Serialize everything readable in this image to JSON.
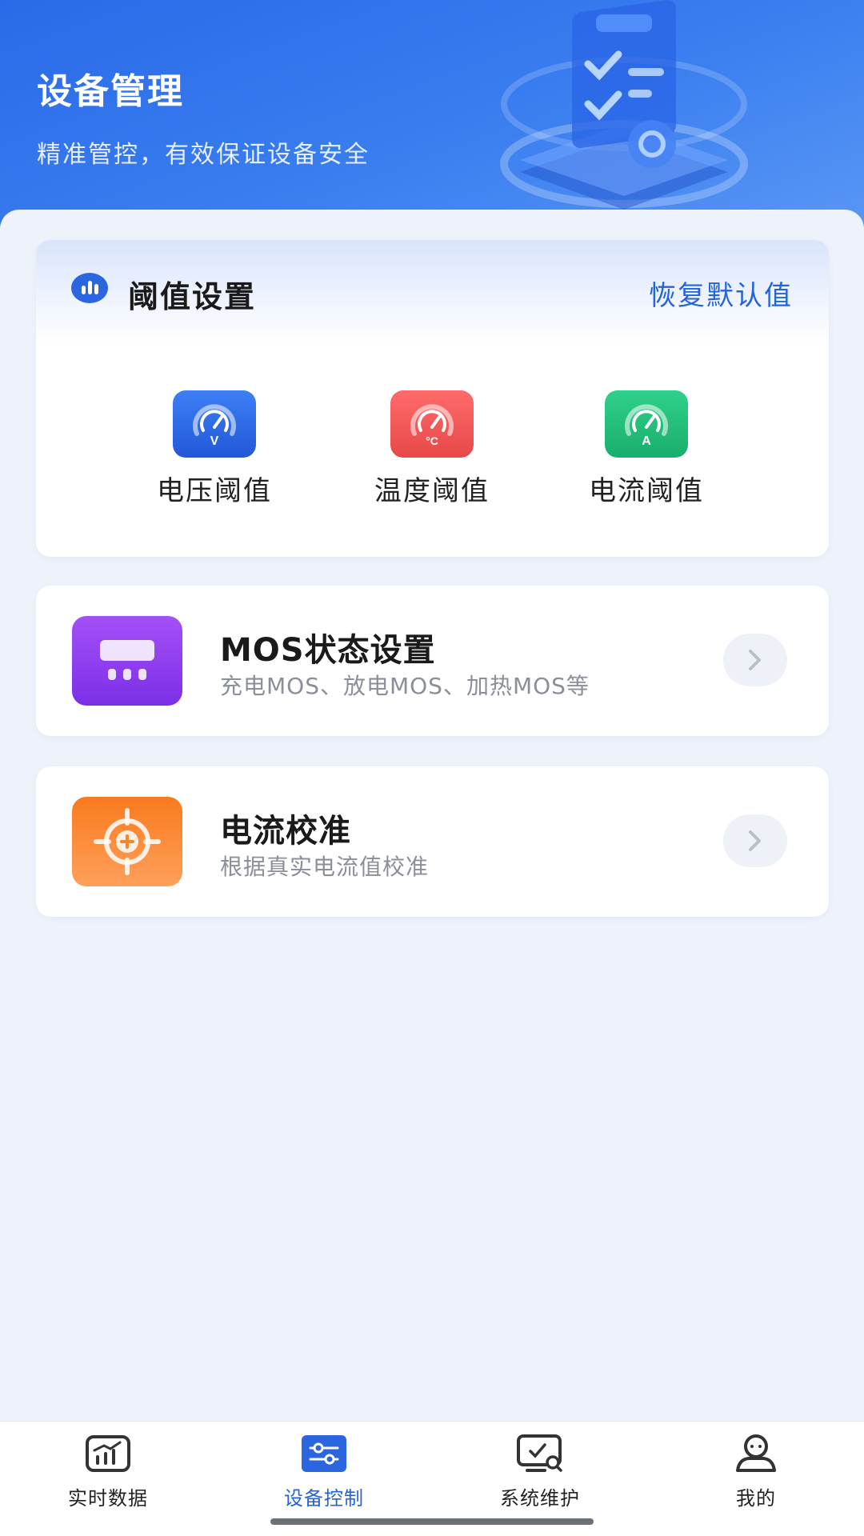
{
  "header": {
    "title": "设备管理",
    "subtitle": "精准管控，有效保证设备安全"
  },
  "threshold": {
    "title": "阈值设置",
    "reset_label": "恢复默认值",
    "items": [
      {
        "label": "电压阈值",
        "icon": "voltage-gauge-icon",
        "color": "#2b66e0"
      },
      {
        "label": "温度阈值",
        "icon": "temperature-gauge-icon",
        "color": "#ee5252"
      },
      {
        "label": "电流阈值",
        "icon": "current-gauge-icon",
        "color": "#1fb874"
      }
    ]
  },
  "mos": {
    "title": "MOS状态设置",
    "subtitle": "充电MOS、放电MOS、加热MOS等",
    "icon": "mos-switch-icon",
    "color": "#8f3ff0"
  },
  "calibration": {
    "title": "电流校准",
    "subtitle": "根据真实电流值校准",
    "icon": "crosshair-target-icon",
    "color": "#f7852a"
  },
  "tabbar": {
    "tabs": [
      {
        "label": "实时数据",
        "icon": "chart-icon",
        "active": false
      },
      {
        "label": "设备控制",
        "icon": "sliders-icon",
        "active": true
      },
      {
        "label": "系统维护",
        "icon": "monitor-search-icon",
        "active": false
      },
      {
        "label": "我的",
        "icon": "user-icon",
        "active": false
      }
    ]
  },
  "colors": {
    "accent": "#2563d9",
    "background": "#eef2fb"
  }
}
